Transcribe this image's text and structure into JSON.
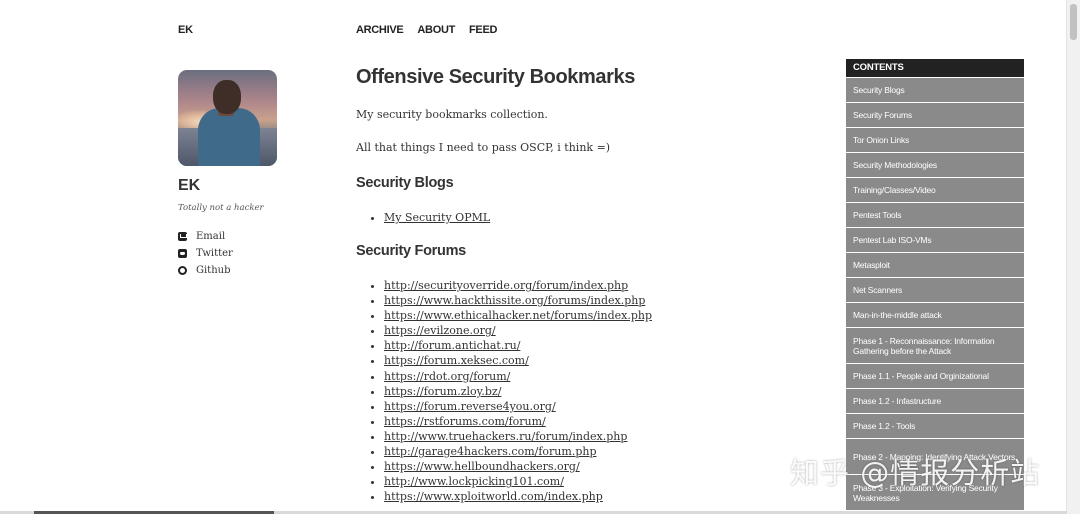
{
  "header": {
    "brand": "EK",
    "nav": [
      "ARCHIVE",
      "ABOUT",
      "FEED"
    ]
  },
  "profile": {
    "name": "EK",
    "tagline": "Totally not a hacker",
    "links": [
      {
        "label": "Email",
        "icon": "email-icon"
      },
      {
        "label": "Twitter",
        "icon": "twitter-icon"
      },
      {
        "label": "Github",
        "icon": "github-icon"
      }
    ]
  },
  "main": {
    "title": "Offensive Security Bookmarks",
    "intro": "My security bookmarks collection.",
    "intro2": "All that things I need to pass OSCP, i think =)",
    "blogs_heading": "Security Blogs",
    "blogs": [
      "My Security OPML"
    ],
    "forums_heading": "Security Forums",
    "forums": [
      "http://securityoverride.org/forum/index.php",
      "https://www.hackthissite.org/forums/index.php",
      "https://www.ethicalhacker.net/forums/index.php",
      "https://evilzone.org/",
      "http://forum.antichat.ru/",
      "https://forum.xeksec.com/",
      "https://rdot.org/forum/",
      "https://forum.zloy.bz/",
      "https://forum.reverse4you.org/",
      "https://rstforums.com/forum/",
      "http://www.truehackers.ru/forum/index.php",
      "http://garage4hackers.com/forum.php",
      "https://www.hellboundhackers.org/",
      "http://www.lockpicking101.com/",
      "https://www.xploitworld.com/index.php"
    ]
  },
  "toc": {
    "title": "CONTENTS",
    "items": [
      "Security Blogs",
      "Security Forums",
      "Tor Onion Links",
      "Security Methodologies",
      "Training/Classes/Video",
      "Pentest Tools",
      "Pentest Lab ISO-VMs",
      "Metasploit",
      "Net Scanners",
      "Man-in-the-middle attack",
      "Phase 1 - Reconnaissance: Information Gathering before the Attack",
      "Phase 1.1 - People and Orginizational",
      "Phase 1.2 - Infastructure",
      "Phase 1.2 - Tools",
      "Phase 2 - Mapping: Identifying Attack Vectors",
      "Phase 3 - Exploitation: Verifying Security Weaknesses"
    ]
  },
  "watermark": "知乎 @情报分析站"
}
